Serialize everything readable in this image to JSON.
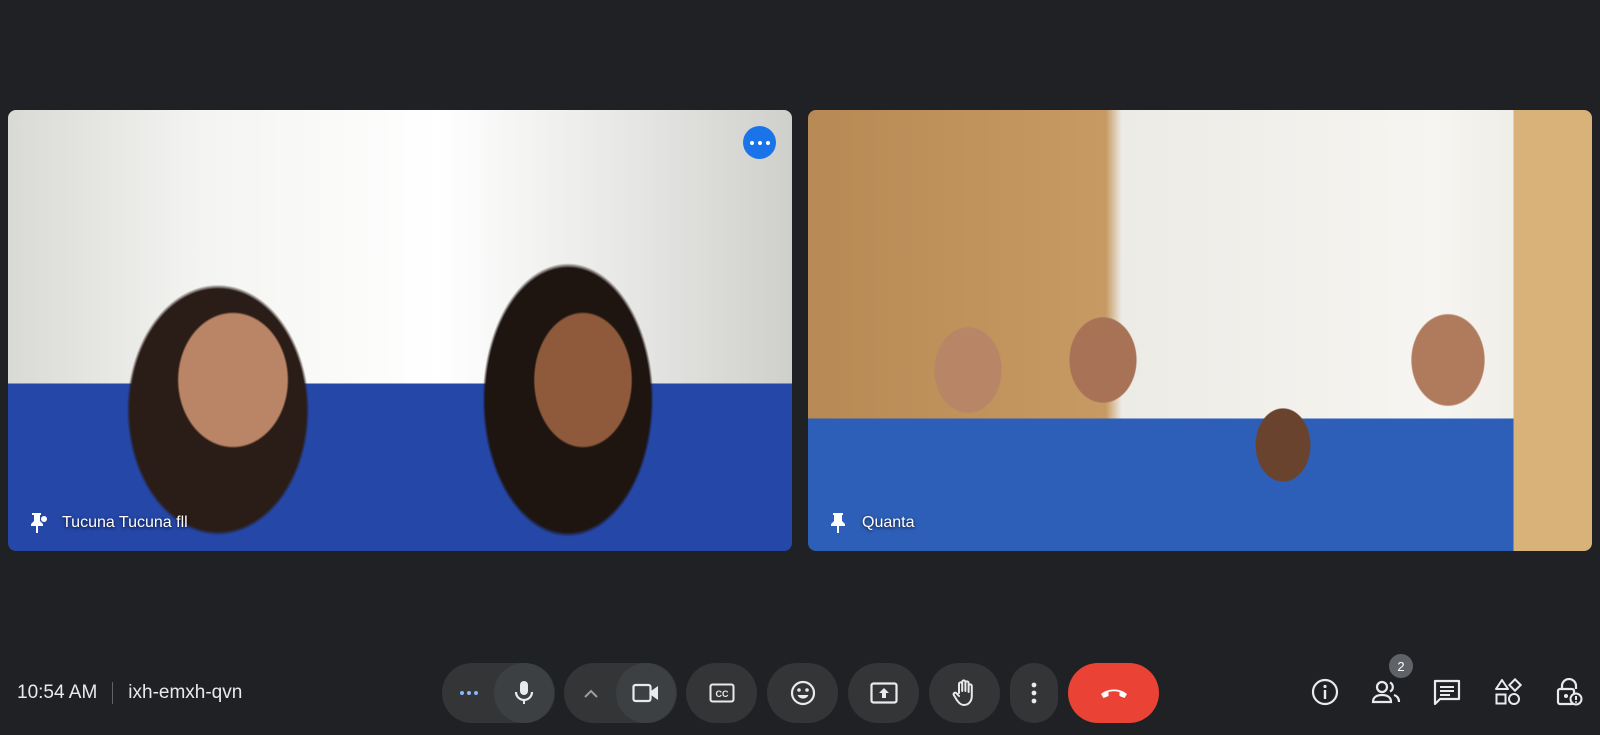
{
  "meeting": {
    "time": "10:54 AM",
    "code": "ixh-emxh-qvn"
  },
  "participants": [
    {
      "name": "Tucuna Tucuna fll",
      "pin_icon": "pin-off-icon",
      "has_more_button": true
    },
    {
      "name": "Quanta",
      "pin_icon": "pin-icon",
      "has_more_button": false
    }
  ],
  "controls": {
    "reactions_more_icon": "more-horiz-icon",
    "mic_icon": "mic-icon",
    "expand_icon": "chevron-up-icon",
    "camera_icon": "videocam-icon",
    "captions_icon": "closed-captions-icon",
    "emoji_icon": "emoji-icon",
    "present_icon": "present-screen-icon",
    "raise_hand_icon": "raise-hand-icon",
    "more_icon": "more-vert-icon",
    "end_call_icon": "call-end-icon"
  },
  "side_tools": {
    "info_icon": "info-icon",
    "people_icon": "people-icon",
    "people_count": "2",
    "chat_icon": "chat-icon",
    "activities_icon": "activities-icon",
    "host_controls_icon": "lock-person-icon"
  },
  "colors": {
    "background": "#202124",
    "control": "#333537",
    "end_call": "#ea4335",
    "accent": "#1a73e8"
  }
}
